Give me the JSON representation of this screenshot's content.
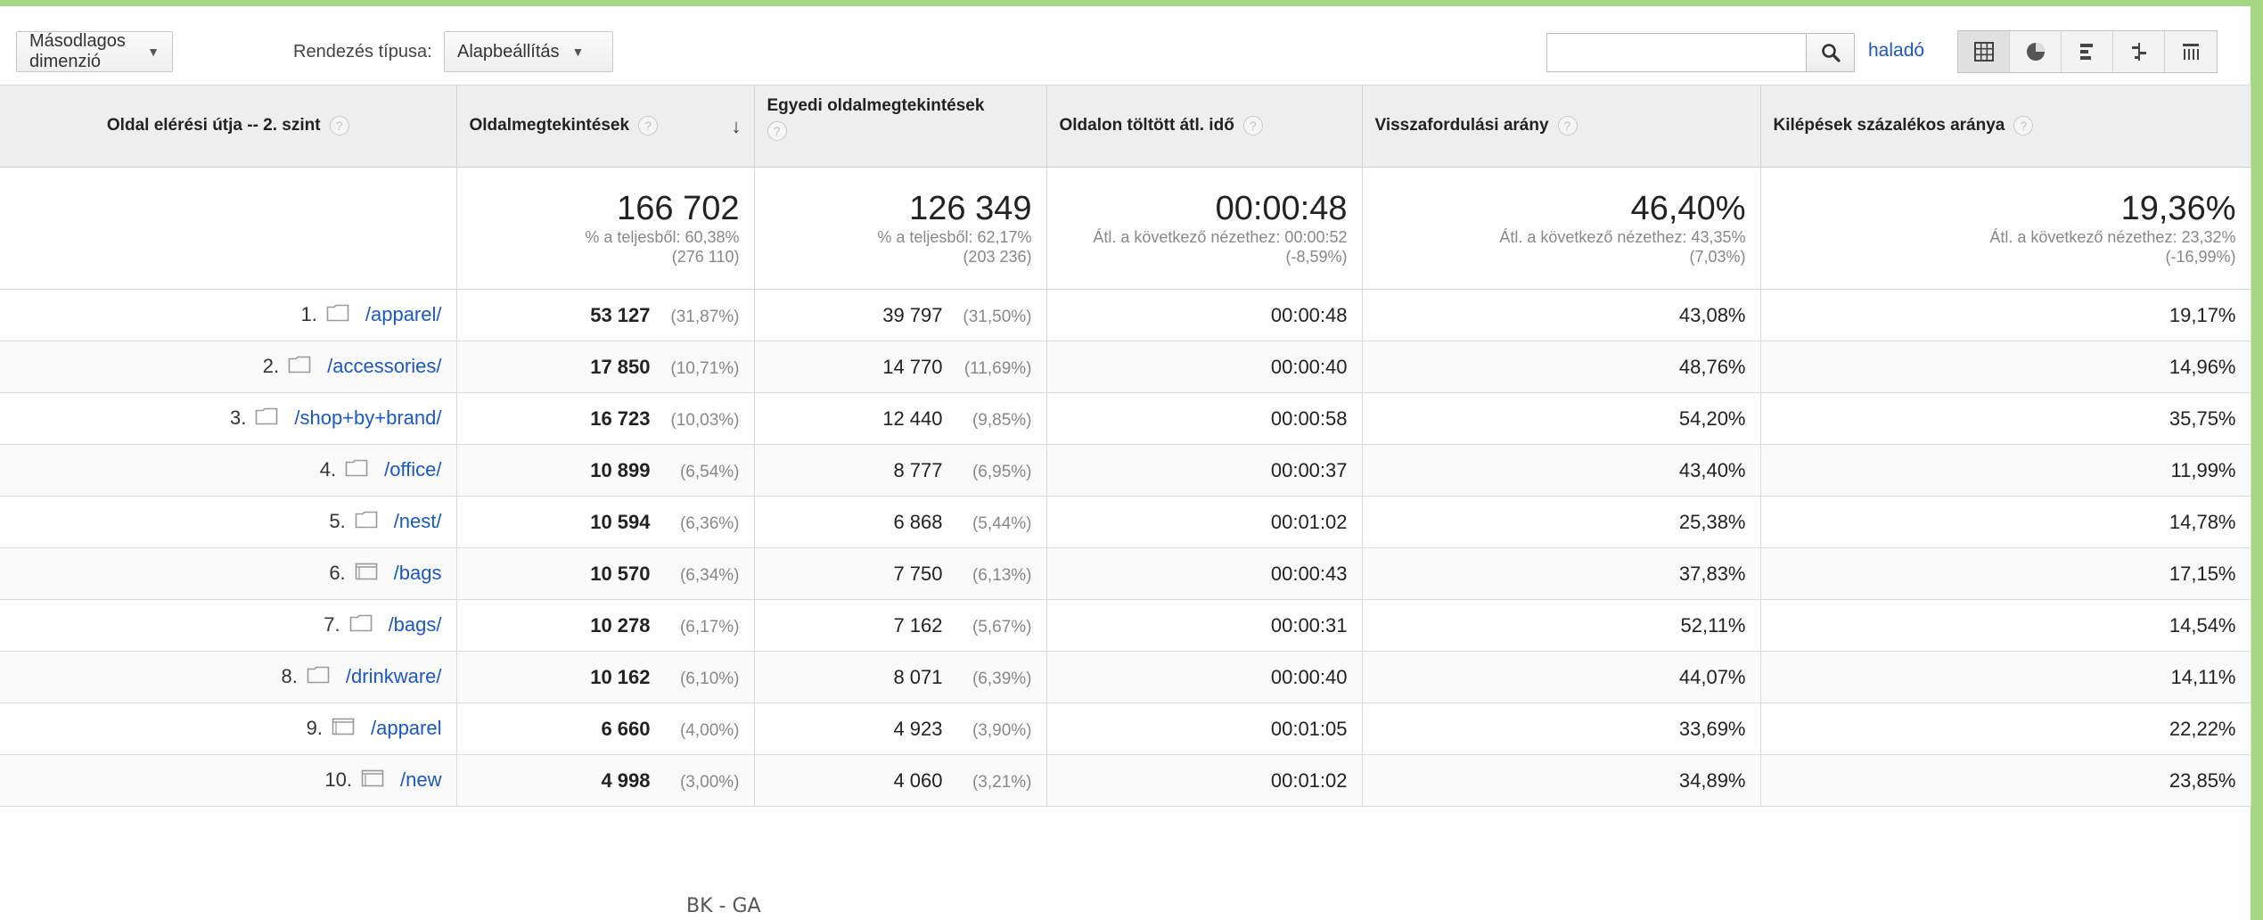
{
  "toolbar": {
    "secondary_dimension": "Másodlagos dimenzió",
    "sort_type_label": "Rendezés típusa:",
    "sort_type_value": "Alapbeállítás",
    "search_placeholder": "",
    "advanced": "haladó"
  },
  "columns": [
    "Oldal elérési útja -- 2. szint",
    "Oldalmegtekintések",
    "Egyedi oldalmegtekintések",
    "Oldalon töltött átl. idő",
    "Visszafordulási arány",
    "Kilépések százalékos aránya"
  ],
  "totals": {
    "pageviews": {
      "value": "166 702",
      "line1": "% a teljesből: 60,38%",
      "line2": "(276 110)"
    },
    "unique": {
      "value": "126 349",
      "line1": "% a teljesből: 62,17%",
      "line2": "(203 236)"
    },
    "time": {
      "value": "00:00:48",
      "line1": "Átl. a következő nézethez: 00:00:52",
      "line2": "(-8,59%)"
    },
    "bounce": {
      "value": "46,40%",
      "line1": "Átl. a következő nézethez: 43,35%",
      "line2": "(7,03%)"
    },
    "exit": {
      "value": "19,36%",
      "line1": "Átl. a következő nézethez: 23,32%",
      "line2": "(-16,99%)"
    }
  },
  "rows": [
    {
      "n": "1.",
      "icon": "folder-icon",
      "path": "/apparel/",
      "pv": "53 127",
      "pv_pct": "(31,87%)",
      "uv": "39 797",
      "uv_pct": "(31,50%)",
      "time": "00:00:48",
      "bounce": "43,08%",
      "exit": "19,17%"
    },
    {
      "n": "2.",
      "icon": "folder-icon",
      "path": "/accessories/",
      "pv": "17 850",
      "pv_pct": "(10,71%)",
      "uv": "14 770",
      "uv_pct": "(11,69%)",
      "time": "00:00:40",
      "bounce": "48,76%",
      "exit": "14,96%"
    },
    {
      "n": "3.",
      "icon": "folder-icon",
      "path": "/shop+by+brand/",
      "pv": "16 723",
      "pv_pct": "(10,03%)",
      "uv": "12 440",
      "uv_pct": "(9,85%)",
      "time": "00:00:58",
      "bounce": "54,20%",
      "exit": "35,75%"
    },
    {
      "n": "4.",
      "icon": "folder-icon",
      "path": "/office/",
      "pv": "10 899",
      "pv_pct": "(6,54%)",
      "uv": "8 777",
      "uv_pct": "(6,95%)",
      "time": "00:00:37",
      "bounce": "43,40%",
      "exit": "11,99%"
    },
    {
      "n": "5.",
      "icon": "folder-icon",
      "path": "/nest/",
      "pv": "10 594",
      "pv_pct": "(6,36%)",
      "uv": "6 868",
      "uv_pct": "(5,44%)",
      "time": "00:01:02",
      "bounce": "25,38%",
      "exit": "14,78%"
    },
    {
      "n": "6.",
      "icon": "page-icon",
      "path": "/bags",
      "pv": "10 570",
      "pv_pct": "(6,34%)",
      "uv": "7 750",
      "uv_pct": "(6,13%)",
      "time": "00:00:43",
      "bounce": "37,83%",
      "exit": "17,15%"
    },
    {
      "n": "7.",
      "icon": "folder-icon",
      "path": "/bags/",
      "pv": "10 278",
      "pv_pct": "(6,17%)",
      "uv": "7 162",
      "uv_pct": "(5,67%)",
      "time": "00:00:31",
      "bounce": "52,11%",
      "exit": "14,54%"
    },
    {
      "n": "8.",
      "icon": "folder-icon",
      "path": "/drinkware/",
      "pv": "10 162",
      "pv_pct": "(6,10%)",
      "uv": "8 071",
      "uv_pct": "(6,39%)",
      "time": "00:00:40",
      "bounce": "44,07%",
      "exit": "14,11%"
    },
    {
      "n": "9.",
      "icon": "page-icon",
      "path": "/apparel",
      "pv": "6 660",
      "pv_pct": "(4,00%)",
      "uv": "4 923",
      "uv_pct": "(3,90%)",
      "time": "00:01:05",
      "bounce": "33,69%",
      "exit": "22,22%"
    },
    {
      "n": "10.",
      "icon": "page-icon",
      "path": "/new",
      "pv": "4 998",
      "pv_pct": "(3,00%)",
      "uv": "4 060",
      "uv_pct": "(3,21%)",
      "time": "00:01:02",
      "bounce": "34,89%",
      "exit": "23,85%"
    }
  ],
  "watermark": "BK - GA",
  "colors": {
    "accent": "#a6d785",
    "link": "#1a58c2"
  }
}
